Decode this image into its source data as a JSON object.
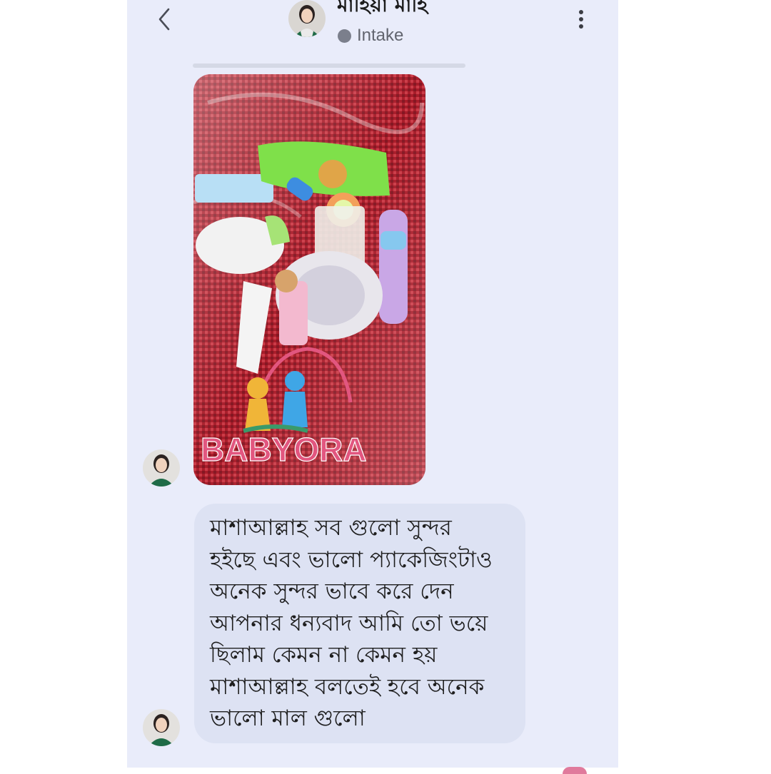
{
  "header": {
    "contact_name": "মাহিয়া মাহি",
    "status": "Intake",
    "icons": {
      "back": "chevron-left-icon",
      "more": "more-vertical-icon"
    }
  },
  "messages": [
    {
      "type": "image",
      "description_icon": "photo",
      "watermark": "BABYORA"
    },
    {
      "type": "text",
      "lines": [
        "মাশাআল্লাহ  সব গুলো সুন্দর",
        "হইছে এবং ভালো প্যাকেজিংটাও",
        "অনেক সুন্দর ভাবে করে দেন",
        "আপনার ধন্যবাদ আমি তো ভয়ে",
        "ছিলাম কেমন না কেমন হয়",
        "মাশাআল্লাহ বলতেই হবে অনেক",
        "ভালো মাল গুলো"
      ]
    }
  ],
  "colors": {
    "panel_bg": "#e9ecfa",
    "bubble_bg": "#dde2f3",
    "status_dot": "#7b7f8c",
    "watermark_pink": "#e2567f"
  }
}
